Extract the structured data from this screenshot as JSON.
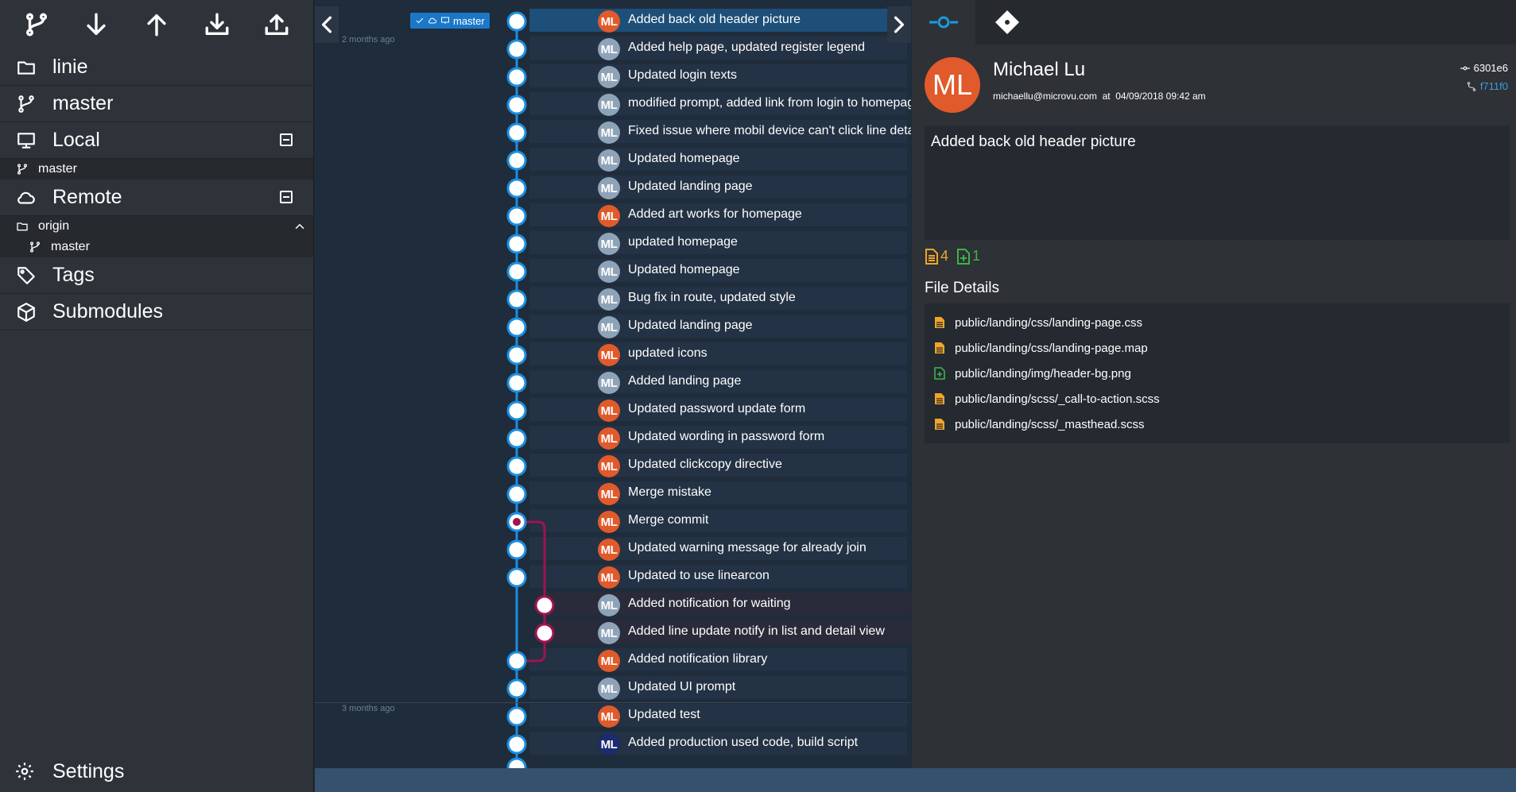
{
  "sidebar": {
    "toolbar": [
      {
        "name": "branch-icon"
      },
      {
        "name": "pull-icon"
      },
      {
        "name": "push-icon"
      },
      {
        "name": "fetch-icon"
      },
      {
        "name": "upload-icon"
      }
    ],
    "repo": "linie",
    "branch": "master",
    "local": {
      "label": "Local",
      "branches": [
        "master"
      ]
    },
    "remote": {
      "label": "Remote",
      "origin": "origin",
      "branches": [
        "master"
      ]
    },
    "tags": "Tags",
    "submodules": "Submodules",
    "settings": "Settings"
  },
  "graph": {
    "ref_badge": "master",
    "time_labels": [
      "2 months ago",
      "3 months ago"
    ],
    "commits": [
      {
        "initials": "ML",
        "color": "orange",
        "message": "Added back old header picture"
      },
      {
        "initials": "ML",
        "color": "grey",
        "message": "Added help page, updated register legend"
      },
      {
        "initials": "ML",
        "color": "grey",
        "message": "Updated login texts"
      },
      {
        "initials": "ML",
        "color": "grey",
        "message": "modified prompt, added link from login to homepage"
      },
      {
        "initials": "ML",
        "color": "grey",
        "message": "Fixed issue where mobil device can't click line details"
      },
      {
        "initials": "ML",
        "color": "grey",
        "message": "Updated homepage"
      },
      {
        "initials": "ML",
        "color": "grey",
        "message": "Updated landing page"
      },
      {
        "initials": "ML",
        "color": "orange",
        "message": "Added art works for homepage"
      },
      {
        "initials": "ML",
        "color": "grey",
        "message": "updated homepage"
      },
      {
        "initials": "ML",
        "color": "grey",
        "message": "Updated homepage"
      },
      {
        "initials": "ML",
        "color": "grey",
        "message": "Bug fix in route, updated style"
      },
      {
        "initials": "ML",
        "color": "grey",
        "message": "Updated landing page"
      },
      {
        "initials": "ML",
        "color": "orange",
        "message": "updated icons"
      },
      {
        "initials": "ML",
        "color": "grey",
        "message": "Added landing page"
      },
      {
        "initials": "ML",
        "color": "orange",
        "message": "Updated password update form"
      },
      {
        "initials": "ML",
        "color": "orange",
        "message": "Updated wording in password form"
      },
      {
        "initials": "ML",
        "color": "orange",
        "message": "Updated clickcopy directive"
      },
      {
        "initials": "ML",
        "color": "orange",
        "message": "Merge mistake"
      },
      {
        "initials": "ML",
        "color": "orange",
        "message": "Merge commit"
      },
      {
        "initials": "ML",
        "color": "orange",
        "message": "Updated warning message for already join"
      },
      {
        "initials": "ML",
        "color": "orange",
        "message": "Updated to use linearcon"
      },
      {
        "initials": "ML",
        "color": "grey",
        "message": "Added notification for waiting"
      },
      {
        "initials": "ML",
        "color": "grey",
        "message": "Added line update notify in list and detail view"
      },
      {
        "initials": "ML",
        "color": "orange",
        "message": "Added notification library"
      },
      {
        "initials": "ML",
        "color": "grey",
        "message": "Updated UI prompt"
      },
      {
        "initials": "ML",
        "color": "orange",
        "message": "Updated test"
      },
      {
        "initials": "ML",
        "color": "navy",
        "message": "Added production used code, build script"
      }
    ]
  },
  "detail": {
    "author_initials": "ML",
    "author_name": "Michael Lu",
    "author_email": "michaellu@microvu.com",
    "at": "at",
    "date": "04/09/2018 09:42 am",
    "sha": "6301e6",
    "parent_sha": "f711f0",
    "message": "Added back old header picture",
    "modified_count": "4",
    "added_count": "1",
    "file_details_title": "File Details",
    "files": [
      {
        "path": "public/landing/css/landing-page.css",
        "status": "modified"
      },
      {
        "path": "public/landing/css/landing-page.map",
        "status": "modified"
      },
      {
        "path": "public/landing/img/header-bg.png",
        "status": "added"
      },
      {
        "path": "public/landing/scss/_call-to-action.scss",
        "status": "modified"
      },
      {
        "path": "public/landing/scss/_masthead.scss",
        "status": "modified"
      }
    ],
    "colors": {
      "modified": "#f0a52a",
      "added": "#3cb44a",
      "accent": "#1b78c8",
      "avatar": "#e05a2b"
    }
  }
}
